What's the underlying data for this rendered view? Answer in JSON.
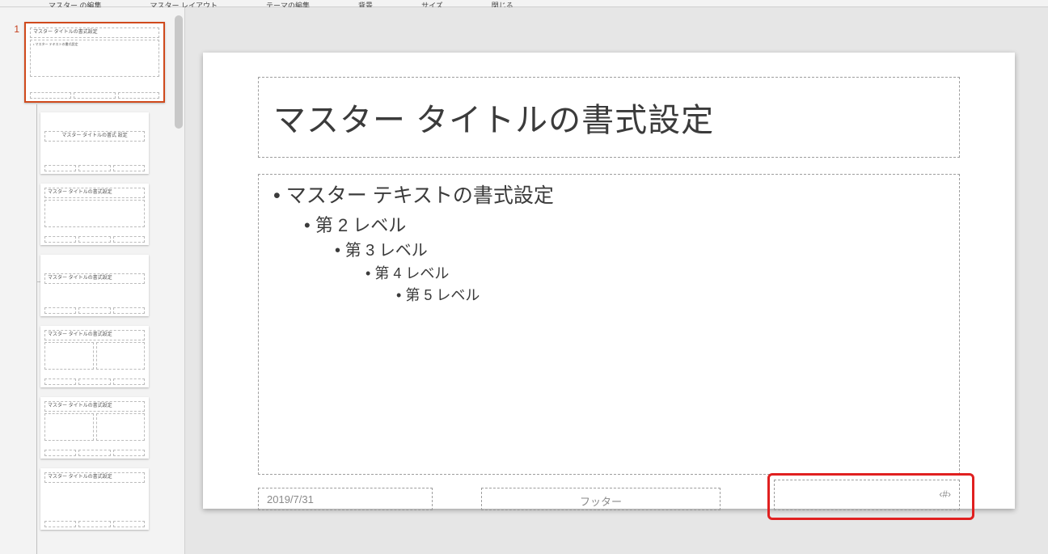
{
  "ribbon": {
    "item1": "マスター の編集",
    "item2": "マスター レイアウト",
    "item3": "テーマの編集",
    "item4": "背景",
    "item5": "サイズ",
    "item6": "閉じる"
  },
  "thumbs": {
    "masterNum": "1",
    "masterTitle": "マスター タイトルの書式設定",
    "masterBody": "• マスター テキストの書式設定",
    "layoutTitle": "マスター タイトルの書式設定",
    "layoutTitle2": "マスター タイトルの書式\n設定"
  },
  "slide": {
    "title": "マスター タイトルの書式設定",
    "body": {
      "l1": "マスター テキストの書式設定",
      "l2": "第 2 レベル",
      "l3": "第 3 レベル",
      "l4": "第 4 レベル",
      "l5": "第 5 レベル"
    },
    "date": "2019/7/31",
    "footer": "フッター",
    "slidenum": "‹#›"
  }
}
